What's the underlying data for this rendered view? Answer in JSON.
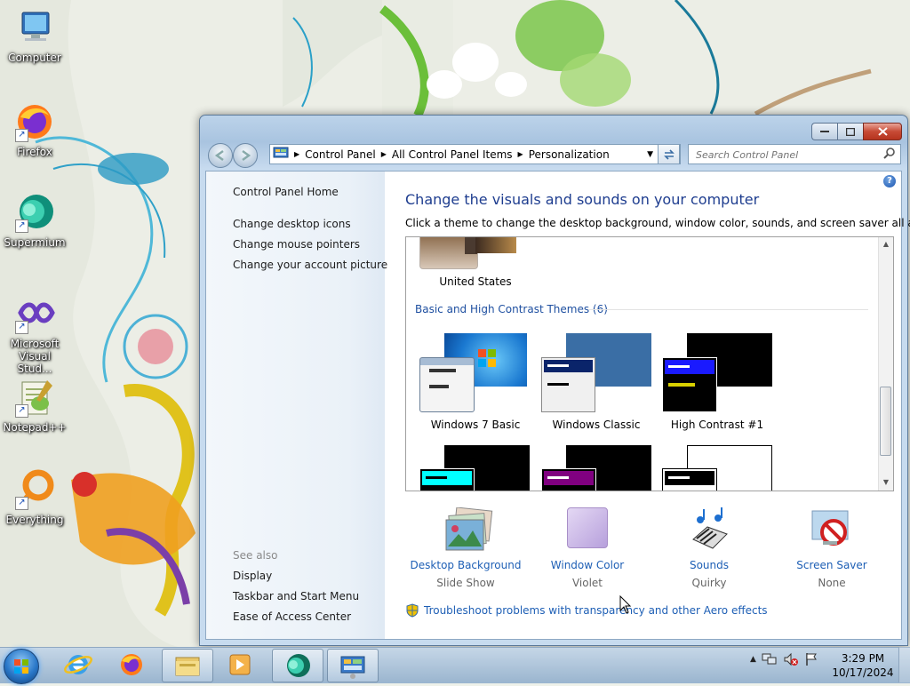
{
  "desktop": {
    "icons": [
      {
        "label": "Computer"
      },
      {
        "label": "Firefox"
      },
      {
        "label": "Supermium"
      },
      {
        "label": "Microsoft Visual Stud..."
      },
      {
        "label": "Notepad++"
      },
      {
        "label": "Everything"
      }
    ]
  },
  "window": {
    "breadcrumb": [
      "Control Panel",
      "All Control Panel Items",
      "Personalization"
    ],
    "search_placeholder": "Search Control Panel",
    "sidebar": {
      "home": "Control Panel Home",
      "links": [
        "Change desktop icons",
        "Change mouse pointers",
        "Change your account picture"
      ],
      "see_also_label": "See also",
      "see_also": [
        "Display",
        "Taskbar and Start Menu",
        "Ease of Access Center"
      ]
    },
    "title": "Change the visuals and sounds on your computer",
    "description": "Click a theme to change the desktop background, window color, sounds, and screen saver all at once.",
    "themes": {
      "top_theme_label": "United States",
      "group_title": "Basic and High Contrast Themes (6)",
      "row1": [
        "Windows 7 Basic",
        "Windows Classic",
        "High Contrast #1"
      ]
    },
    "bottom": [
      {
        "label": "Desktop Background",
        "value": "Slide Show"
      },
      {
        "label": "Window Color",
        "value": "Violet"
      },
      {
        "label": "Sounds",
        "value": "Quirky"
      },
      {
        "label": "Screen Saver",
        "value": "None"
      }
    ],
    "troubleshoot": "Troubleshoot problems with transparency and other Aero effects"
  },
  "taskbar": {
    "time": "3:29 PM",
    "date": "10/17/2024"
  },
  "colors": {
    "link_blue": "#1e5fb5",
    "title_blue": "#1e3d8f",
    "window_color_violet": "#c9b8e6"
  }
}
